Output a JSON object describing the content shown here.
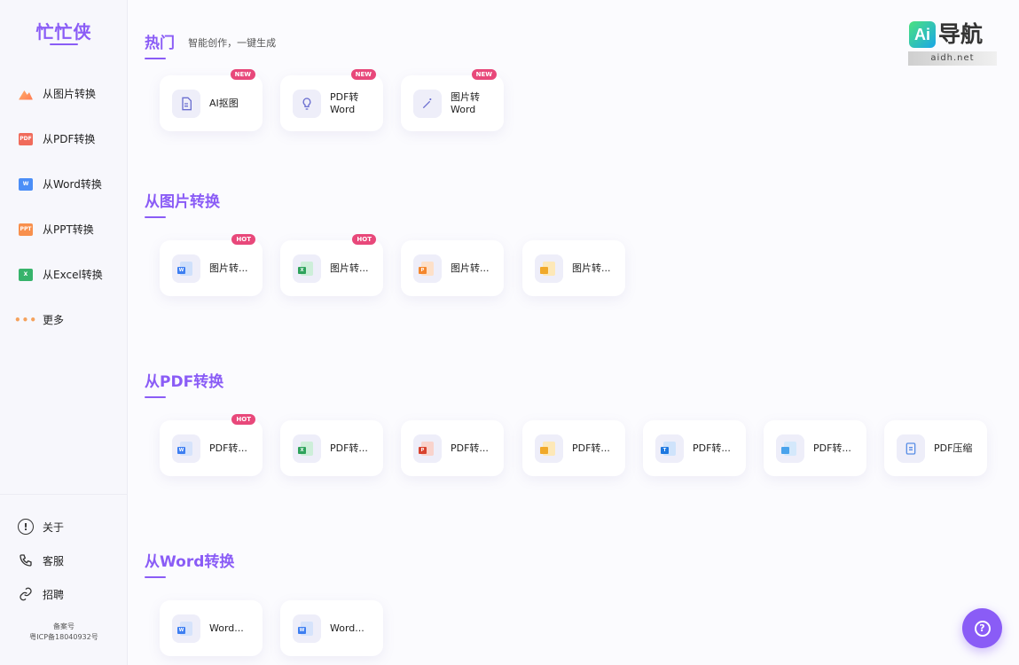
{
  "brand": "忙忙侠",
  "sidebar": {
    "items": [
      {
        "label": "从图片转换",
        "icon": "image-icon"
      },
      {
        "label": "从PDF转换",
        "icon": "pdf-icon"
      },
      {
        "label": "从Word转换",
        "icon": "word-icon"
      },
      {
        "label": "从PPT转换",
        "icon": "ppt-icon"
      },
      {
        "label": "从Excel转换",
        "icon": "excel-icon"
      },
      {
        "label": "更多",
        "icon": "more-icon"
      }
    ],
    "footer": [
      {
        "label": "关于",
        "icon": "info-icon"
      },
      {
        "label": "客服",
        "icon": "phone-icon"
      },
      {
        "label": "招聘",
        "icon": "link-icon"
      }
    ],
    "icp_line1": "备案号",
    "icp_line2": "粤ICP备18040932号"
  },
  "sections": {
    "hot": {
      "title": "热门",
      "subtitle": "智能创作，一键生成",
      "cards": [
        {
          "label": "AI抠图",
          "badge": "NEW"
        },
        {
          "label": "PDF转Word",
          "badge": "NEW"
        },
        {
          "label": "图片转Word",
          "badge": "NEW"
        }
      ]
    },
    "image": {
      "title": "从图片转换",
      "cards": [
        {
          "label": "图片转...",
          "badge": "HOT"
        },
        {
          "label": "图片转...",
          "badge": "HOT"
        },
        {
          "label": "图片转...",
          "badge": ""
        },
        {
          "label": "图片转...",
          "badge": ""
        }
      ]
    },
    "pdf": {
      "title": "从PDF转换",
      "cards": [
        {
          "label": "PDF转...",
          "badge": "HOT"
        },
        {
          "label": "PDF转...",
          "badge": ""
        },
        {
          "label": "PDF转...",
          "badge": ""
        },
        {
          "label": "PDF转...",
          "badge": ""
        },
        {
          "label": "PDF转...",
          "badge": ""
        },
        {
          "label": "PDF转...",
          "badge": ""
        },
        {
          "label": "PDF压缩",
          "badge": ""
        }
      ]
    },
    "word": {
      "title": "从Word转换",
      "cards": [
        {
          "label": "Word...",
          "badge": ""
        },
        {
          "label": "Word...",
          "badge": ""
        }
      ]
    }
  },
  "logo": {
    "ai": "Ai",
    "text": "导航",
    "url": "aidh.net"
  },
  "help_icon": "question-icon"
}
